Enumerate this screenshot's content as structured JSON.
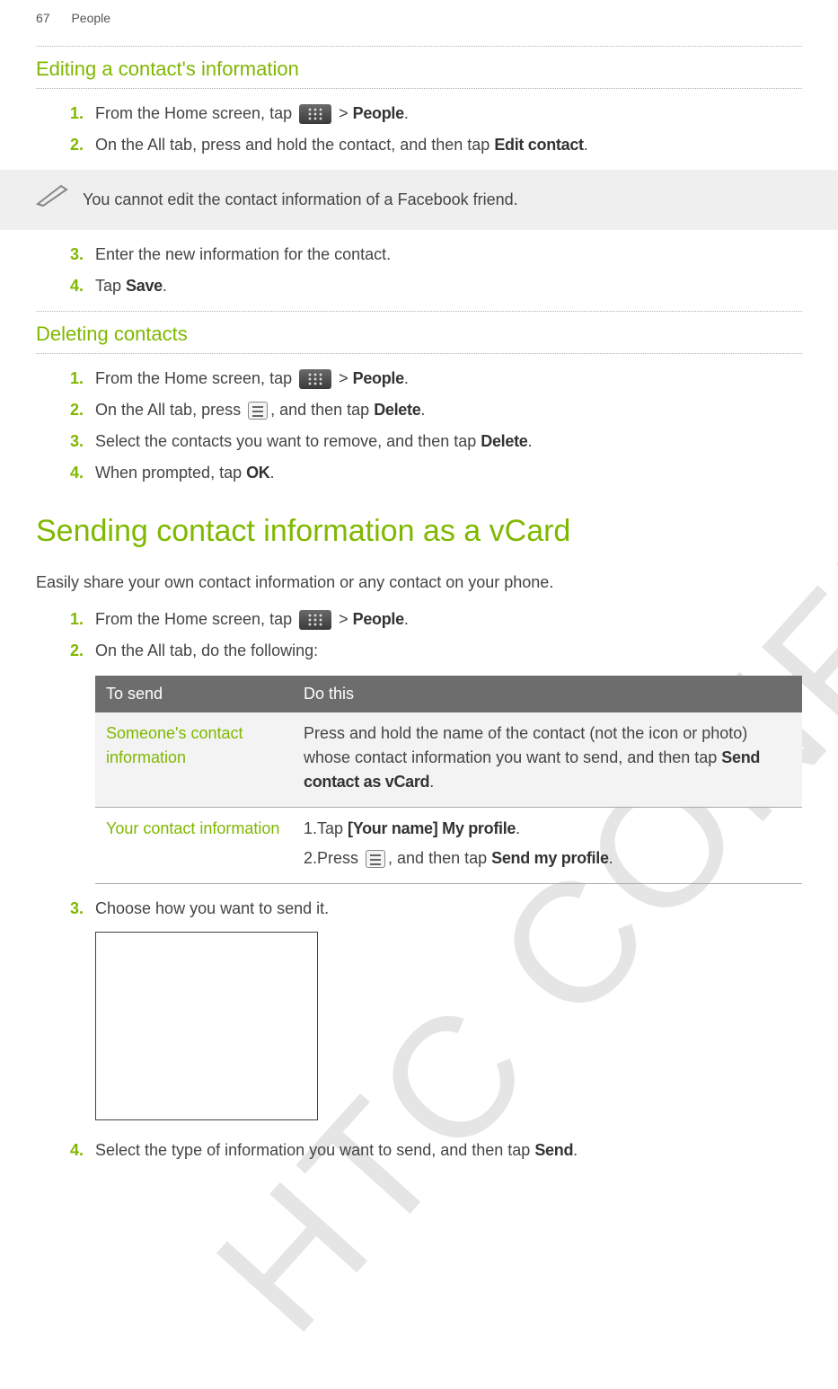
{
  "header": {
    "page_number": "67",
    "section": "People"
  },
  "watermark": "HTC CONFIDENTIAL",
  "sec1": {
    "title": "Editing a contact's information",
    "steps": {
      "s1_pre": "From the Home screen, tap ",
      "s1_post": " > ",
      "s1_bold": "People",
      "s1_dot": ".",
      "s2_pre": "On the All tab, press and hold the contact, and then tap ",
      "s2_bold": "Edit contact",
      "s2_dot": ".",
      "note": "You cannot edit the contact information of a Facebook friend.",
      "s3": "Enter the new information for the contact.",
      "s4_pre": "Tap ",
      "s4_bold": "Save",
      "s4_dot": "."
    }
  },
  "sec2": {
    "title": "Deleting contacts",
    "steps": {
      "s1_pre": "From the Home screen, tap ",
      "s1_post": " > ",
      "s1_bold": "People",
      "s1_dot": ".",
      "s2_pre": "On the All tab, press ",
      "s2_post": ", and then tap ",
      "s2_bold": "Delete",
      "s2_dot": ".",
      "s3_pre": "Select the contacts you want to remove, and then tap ",
      "s3_bold": "Delete",
      "s3_dot": ".",
      "s4_pre": "When prompted, tap ",
      "s4_bold": "OK",
      "s4_dot": "."
    }
  },
  "sec3": {
    "title": "Sending contact information as a vCard",
    "intro": "Easily share your own contact information or any contact on your phone.",
    "steps": {
      "s1_pre": "From the Home screen, tap ",
      "s1_post": " > ",
      "s1_bold": "People",
      "s1_dot": ".",
      "s2": "On the All tab, do the following:",
      "table": {
        "h1": "To send",
        "h2": "Do this",
        "r1c1": "Someone's contact information",
        "r1c2_pre": "Press and hold the name of the contact (not the icon or photo) whose contact information you want to send, and then tap ",
        "r1c2_bold": "Send contact as vCard",
        "r1c2_dot": ".",
        "r2c1": "Your contact information",
        "r2c2_a_pre": "Tap ",
        "r2c2_a_bold": "[Your name] My profile",
        "r2c2_a_dot": ".",
        "r2c2_b_pre": "Press ",
        "r2c2_b_post": ", and then tap ",
        "r2c2_b_bold": "Send my profile",
        "r2c2_b_dot": "."
      },
      "s3": "Choose how you want to send it.",
      "s4_pre": "Select the type of information you want to send, and then tap ",
      "s4_bold": "Send",
      "s4_dot": "."
    }
  },
  "numbers": {
    "n1": "1.",
    "n2": "2.",
    "n3": "3.",
    "n4": "4."
  }
}
